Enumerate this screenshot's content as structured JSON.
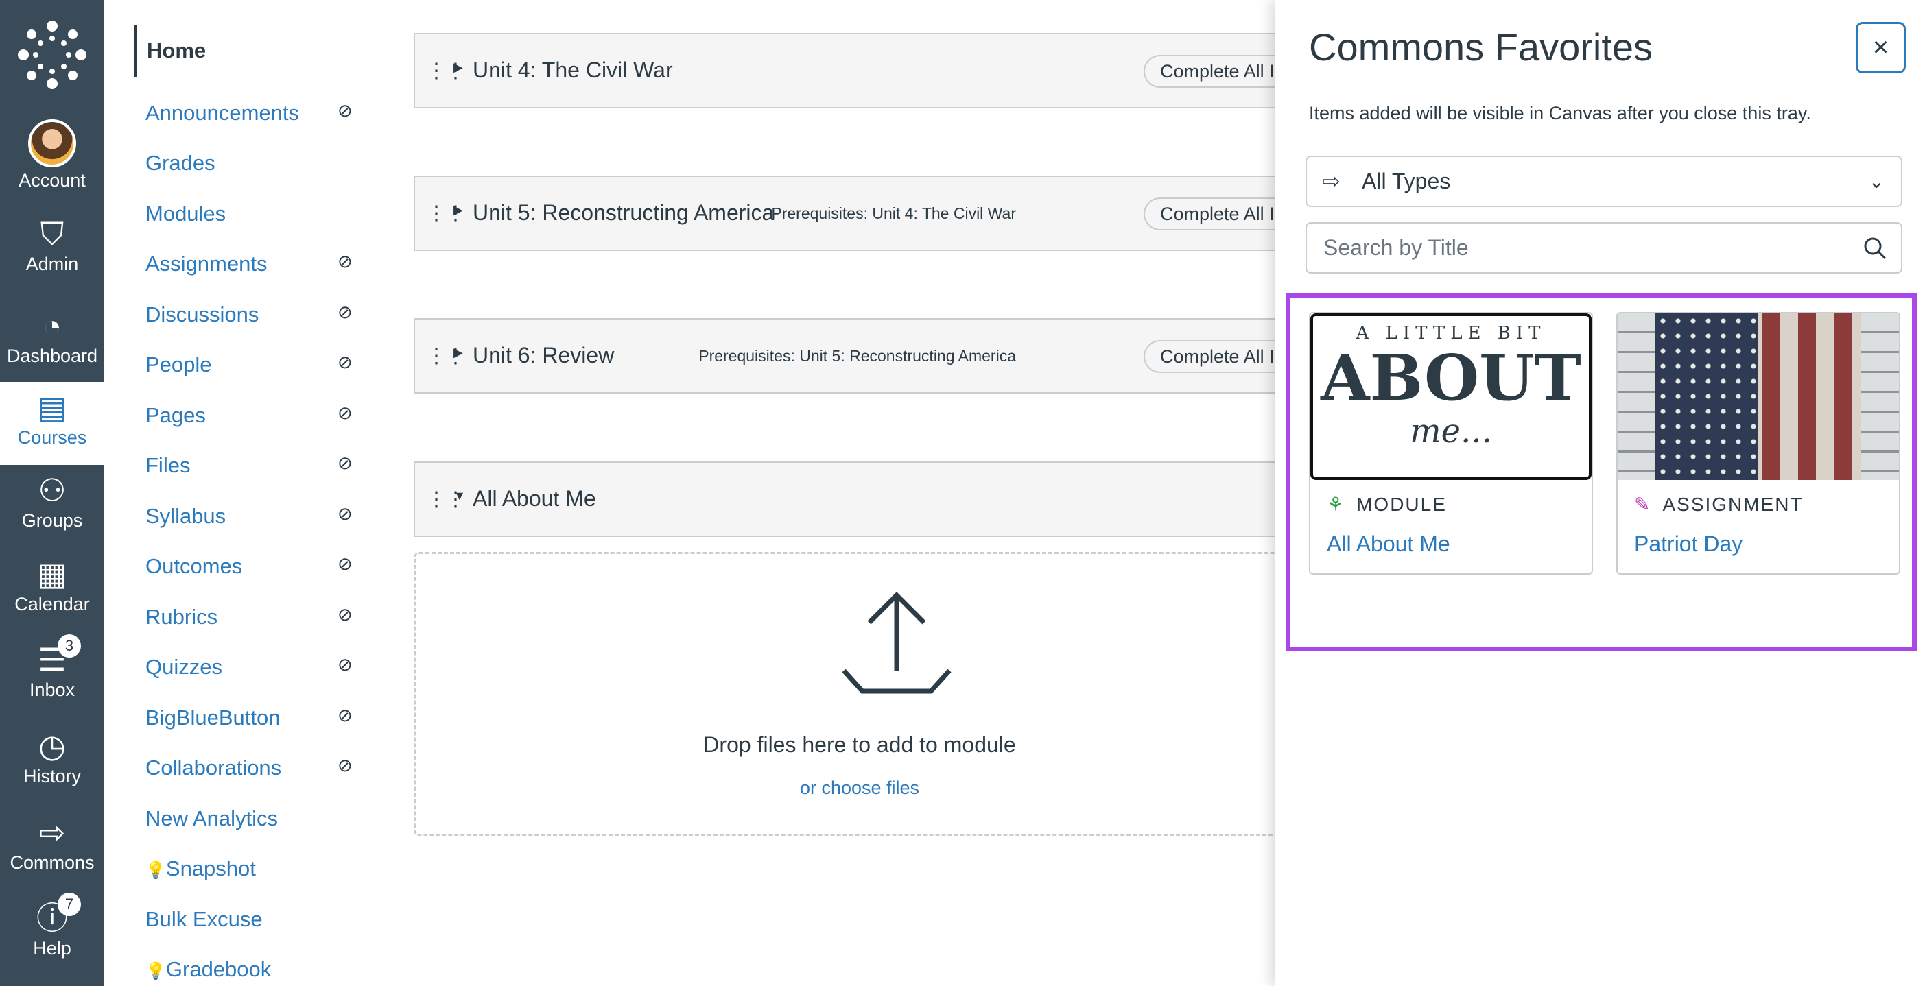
{
  "global_nav": {
    "items": [
      {
        "label": "Account",
        "icon": "avatar"
      },
      {
        "label": "Admin",
        "icon": "shield-key-icon"
      },
      {
        "label": "Dashboard",
        "icon": "dashboard-icon"
      },
      {
        "label": "Courses",
        "icon": "courses-icon",
        "active": true
      },
      {
        "label": "Groups",
        "icon": "groups-icon"
      },
      {
        "label": "Calendar",
        "icon": "calendar-icon"
      },
      {
        "label": "Inbox",
        "icon": "inbox-icon",
        "badge": "3"
      },
      {
        "label": "History",
        "icon": "clock-icon"
      },
      {
        "label": "Commons",
        "icon": "commons-icon"
      },
      {
        "label": "Help",
        "icon": "help-icon",
        "badge": "7"
      }
    ]
  },
  "course_nav": {
    "items": [
      {
        "label": "Home"
      },
      {
        "label": "Announcements",
        "hidden": true
      },
      {
        "label": "Grades"
      },
      {
        "label": "Modules"
      },
      {
        "label": "Assignments",
        "hidden": true
      },
      {
        "label": "Discussions",
        "hidden": true
      },
      {
        "label": "People",
        "hidden": true
      },
      {
        "label": "Pages",
        "hidden": true
      },
      {
        "label": "Files",
        "hidden": true
      },
      {
        "label": "Syllabus",
        "hidden": true
      },
      {
        "label": "Outcomes",
        "hidden": true
      },
      {
        "label": "Rubrics",
        "hidden": true
      },
      {
        "label": "Quizzes",
        "hidden": true
      },
      {
        "label": "BigBlueButton",
        "hidden": true
      },
      {
        "label": "Collaborations",
        "hidden": true
      },
      {
        "label": "New Analytics"
      },
      {
        "label": "Snapshot",
        "bulb": true
      },
      {
        "label": "Bulk Excuse"
      },
      {
        "label": "Gradebook",
        "bulb": true
      }
    ]
  },
  "modules": [
    {
      "title": "Unit 4: The Civil War",
      "prerequisites": "",
      "button": "Complete All I",
      "collapsed": true
    },
    {
      "title": "Unit 5: Reconstructing America",
      "prerequisites": "Prerequisites: Unit 4: The Civil War",
      "button": "Complete All I",
      "collapsed": true
    },
    {
      "title": "Unit 6: Review",
      "prerequisites": "Prerequisites: Unit 5: Reconstructing America",
      "button": "Complete All I",
      "collapsed": true
    },
    {
      "title": "All About Me",
      "prerequisites": "",
      "collapsed": false
    }
  ],
  "dropzone": {
    "text": "Drop files here to add to module",
    "link": "or choose files"
  },
  "tray": {
    "title": "Commons Favorites",
    "close": "×",
    "description": "Items added will be visible in Canvas after you close this tray.",
    "type_select": "All Types",
    "search_placeholder": "Search by Title",
    "highlight_color": "#ab47e8",
    "cards": [
      {
        "type": "MODULE",
        "name": "All About Me",
        "type_color": "#2a9d3f",
        "image_text": [
          "A LITTLE BIT",
          "ABOUT",
          "me..."
        ]
      },
      {
        "type": "ASSIGNMENT",
        "name": "Patriot Day",
        "type_color": "#c23fb5"
      }
    ]
  }
}
